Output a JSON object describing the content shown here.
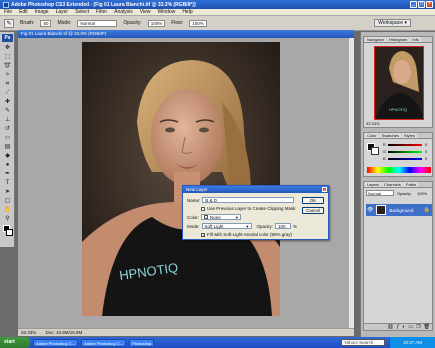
{
  "window": {
    "title": "Adobe Photoshop CS3 Extended - [Fig 01 Laura Bianchi.tif @ 33.3% (RGB/8*)]"
  },
  "menu": [
    "File",
    "Edit",
    "Image",
    "Layer",
    "Select",
    "Filter",
    "Analysis",
    "View",
    "Window",
    "Help"
  ],
  "options": {
    "brush_label": "Brush:",
    "brush_size": "50",
    "mode_label": "Mode:",
    "mode_value": "Normal",
    "opacity_label": "Opacity:",
    "opacity_value": "100%",
    "flow_label": "Flow:",
    "flow_value": "100%",
    "workspace": "Workspace ▾"
  },
  "toolbox": {
    "logo": "Ps"
  },
  "document": {
    "title": "Fig 01 Laura Bianchi.tif @ 33.3% (RGB/8*)",
    "zoom": "33.33%",
    "status": "Doc: 10.9M/10.9M"
  },
  "image": {
    "shirt_text": "HPNOTIQ"
  },
  "navigator": {
    "tabs": [
      "Navigator",
      "Histogram",
      "Info"
    ],
    "zoom": "33.33%",
    "thumb_text": "HPNOTIQ"
  },
  "color_panel": {
    "tabs": [
      "Color",
      "Swatches",
      "Styles"
    ],
    "channels": [
      "R",
      "G",
      "B"
    ],
    "values": [
      "0",
      "0",
      "0"
    ]
  },
  "layers": {
    "tabs": [
      "Layers",
      "Channels",
      "Paths"
    ],
    "blend_mode": "Normal",
    "opacity_label": "Opacity:",
    "opacity_value": "100%",
    "layer_name": "Background"
  },
  "dialog": {
    "title": "New Layer",
    "name_label": "Name:",
    "name_value": "B & D",
    "clip_label": "Use Previous Layer to Create Clipping Mask",
    "color_label": "Color:",
    "color_value": "None",
    "mode_label": "Mode:",
    "mode_value": "Soft Light",
    "opacity_label": "Opacity:",
    "opacity_value": "100",
    "opacity_unit": "%",
    "fill_label": "Fill with Soft-Light-neutral color (50% gray)",
    "ok": "OK",
    "cancel": "Cancel"
  },
  "taskbar": {
    "start": "start",
    "tasks": [
      "Adobe Photoshop C...",
      "Adobe Photoshop C...",
      "Photoshop"
    ],
    "search": "Yahoo! Search",
    "clock": "10:37 AM"
  }
}
